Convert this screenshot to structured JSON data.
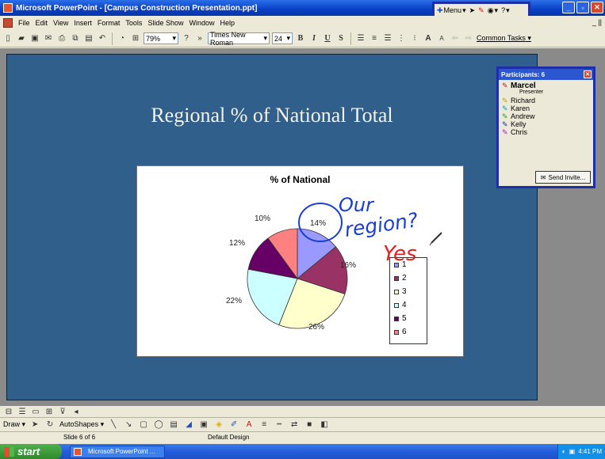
{
  "window": {
    "title": "Microsoft PowerPoint - [Campus Construction Presentation.ppt]"
  },
  "floating_toolbar": {
    "menu_label": "Menu"
  },
  "menu": {
    "items": [
      "File",
      "Edit",
      "View",
      "Insert",
      "Format",
      "Tools",
      "Slide Show",
      "Window",
      "Help"
    ],
    "doc_controls": "_ ||"
  },
  "toolbar": {
    "zoom": "79%",
    "font_name": "Times New Roman",
    "font_size": "24",
    "bold": "B",
    "italic": "I",
    "underline": "U",
    "shadow": "S",
    "common_tasks": "Common Tasks"
  },
  "slide": {
    "title": "Regional % of National Total",
    "chart_data": {
      "type": "pie",
      "title": "% of National",
      "categories": [
        "1",
        "2",
        "3",
        "4",
        "5",
        "6"
      ],
      "values": [
        14,
        16,
        26,
        22,
        12,
        10
      ],
      "labels": [
        "14%",
        "16%",
        "26%",
        "22%",
        "12%",
        "10%"
      ],
      "colors": [
        "#9999ff",
        "#993366",
        "#ffffcc",
        "#ccffff",
        "#660066",
        "#ff8080"
      ],
      "legend": "right"
    },
    "annotations": {
      "text1": "Our",
      "text2": "region?",
      "text3": "Yes",
      "ink_blue": "#1a3fd0",
      "ink_red": "#e02020"
    }
  },
  "participants": {
    "header": "Participants: 6",
    "presenter_role": "Presenter",
    "people": [
      {
        "name": "Marcel",
        "pen_color": "#b0182a"
      },
      {
        "name": "Richard",
        "pen_color": "#b8a010"
      },
      {
        "name": "Karen",
        "pen_color": "#10a0b0"
      },
      {
        "name": "Andrew",
        "pen_color": "#20a030"
      },
      {
        "name": "Kelly",
        "pen_color": "#1a2aa0"
      },
      {
        "name": "Chris",
        "pen_color": "#a020c0"
      }
    ],
    "send_invite": "Send Invite..."
  },
  "drawing_toolbar": {
    "draw_label": "Draw",
    "autoshapes_label": "AutoShapes"
  },
  "status": {
    "slide": "Slide 6 of 6",
    "design": "Default Design"
  },
  "taskbar": {
    "start_label": "start",
    "app_item": "Microsoft PowerPoint ...",
    "clock": "4:41 PM"
  }
}
